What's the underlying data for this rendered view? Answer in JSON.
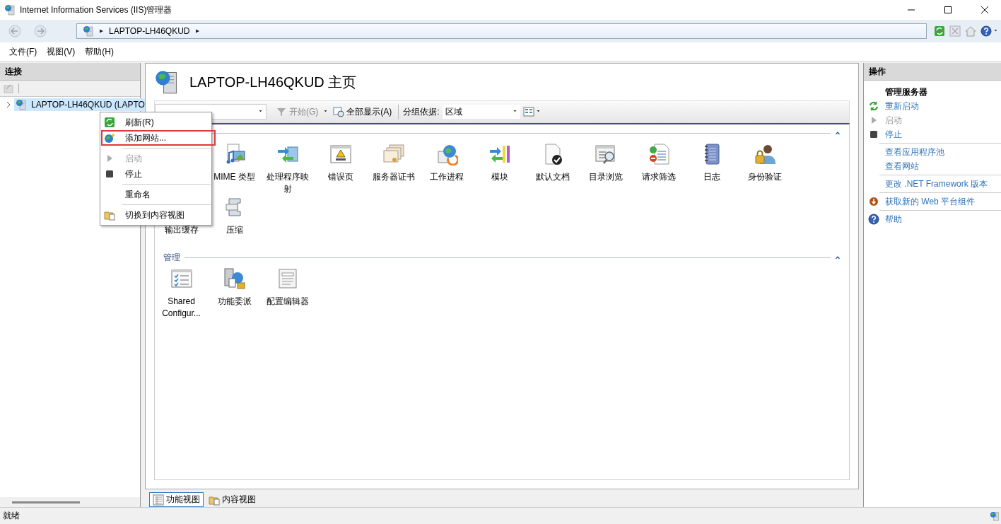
{
  "window": {
    "title": "Internet Information Services (IIS)管理器"
  },
  "address": {
    "segments": [
      "LAPTOP-LH46QKUD"
    ]
  },
  "menu_bar": [
    {
      "label": "文件(F)"
    },
    {
      "label": "视图(V)"
    },
    {
      "label": "帮助(H)"
    }
  ],
  "connections": {
    "title": "连接",
    "tree": [
      {
        "label": "LAPTOP-LH46QKUD (LAPTO",
        "selected": true,
        "expanded": false
      }
    ]
  },
  "home": {
    "title": "LAPTOP-LH46QKUD 主页",
    "toolbar": {
      "buttons": [
        {
          "label": "开始(G)",
          "kind": "filter",
          "disabled": true
        },
        {
          "label": "全部显示(A)",
          "kind": "show-all",
          "disabled": false
        }
      ],
      "group_by_label": "分组依据:",
      "group_by": "区域"
    },
    "groups": [
      {
        "expanded": true,
        "features": [
          {
            "label": "MIME 类型",
            "kind": "mime"
          },
          {
            "label": "处理程序映射",
            "kind": "handler"
          },
          {
            "label": "错误页",
            "kind": "error"
          },
          {
            "label": "服务器证书",
            "kind": "cert"
          },
          {
            "label": "工作进程",
            "kind": "worker"
          },
          {
            "label": "模块",
            "kind": "module"
          },
          {
            "label": "默认文档",
            "kind": "doc"
          },
          {
            "label": "目录浏览",
            "kind": "dirbrowse"
          },
          {
            "label": "请求筛选",
            "kind": "filter"
          },
          {
            "label": "日志",
            "kind": "log"
          },
          {
            "label": "身份验证",
            "kind": "auth"
          },
          {
            "label": "输出缓存",
            "kind": "covered"
          },
          {
            "label": "压缩",
            "kind": "compress"
          }
        ]
      },
      {
        "title": "管理",
        "expanded": true,
        "features": [
          {
            "label": "Shared Configur...",
            "kind": "shared"
          },
          {
            "label": "功能委派",
            "kind": "delegation"
          },
          {
            "label": "配置编辑器",
            "kind": "configed"
          }
        ]
      }
    ]
  },
  "view_tabs": [
    {
      "label": "功能视图",
      "kind": "features",
      "selected": true
    },
    {
      "label": "内容视图",
      "kind": "content",
      "selected": false
    }
  ],
  "actions": {
    "title": "操作",
    "items": [
      {
        "kind": "heading",
        "label": "管理服务器"
      },
      {
        "kind": "restart",
        "label": "重新启动",
        "disabled": false
      },
      {
        "kind": "start",
        "label": "启动",
        "disabled": true
      },
      {
        "kind": "stop",
        "label": "停止",
        "disabled": false
      },
      {
        "kind": "separator"
      },
      {
        "kind": "link",
        "label": "查看应用程序池",
        "disabled": false
      },
      {
        "kind": "link",
        "label": "查看网站",
        "disabled": false
      },
      {
        "kind": "separator"
      },
      {
        "kind": "link",
        "label": "更改 .NET Framework 版本",
        "disabled": false
      },
      {
        "kind": "separator"
      },
      {
        "kind": "download",
        "label": "获取新的 Web 平台组件",
        "disabled": false
      },
      {
        "kind": "separator"
      },
      {
        "kind": "help",
        "label": "帮助",
        "disabled": false
      }
    ]
  },
  "context_menu": {
    "items": [
      {
        "kind": "refresh",
        "label": "刷新(R)",
        "disabled": false,
        "highlighted": false
      },
      {
        "kind": "add-site",
        "label": "添加网站...",
        "disabled": false,
        "highlighted": true
      },
      {
        "kind": "separator"
      },
      {
        "kind": "start",
        "label": "启动",
        "disabled": true,
        "highlighted": false
      },
      {
        "kind": "stop",
        "label": "停止",
        "disabled": false,
        "highlighted": false
      },
      {
        "kind": "separator"
      },
      {
        "kind": "plain",
        "label": "重命名",
        "disabled": false,
        "highlighted": false
      },
      {
        "kind": "separator"
      },
      {
        "kind": "content-view",
        "label": "切换到内容视图",
        "disabled": false,
        "highlighted": false
      }
    ]
  },
  "status_bar": {
    "text": "就绪"
  }
}
